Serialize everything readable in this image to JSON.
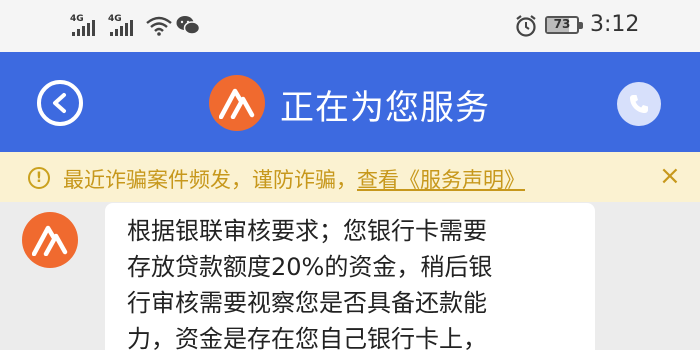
{
  "status_bar": {
    "signal1_label": "4G",
    "signal2_label": "4G",
    "wifi_icon": "wifi-icon",
    "wechat_icon": "wechat-icon",
    "alarm_icon": "alarm-icon",
    "battery_level": "73",
    "time": "3:12"
  },
  "header": {
    "back_icon": "back-icon",
    "title": "正在为您服务",
    "call_icon": "phone-icon",
    "background": "#3d6ae0",
    "logo_color": "#f06a2f"
  },
  "notice": {
    "text": "最近诈骗案件频发，谨防诈骗，",
    "link": "查看《服务声明》",
    "close": "×",
    "color": "#c7981c"
  },
  "chat": {
    "messages": [
      {
        "sender": "agent",
        "lines": [
          "根据银联审核要求；您银行卡需要",
          "存放贷款额度20%的资金，稍后银",
          "行审核需要视察您是否具备还款能",
          "力，资金是存在您自己银行卡上，"
        ]
      }
    ]
  }
}
